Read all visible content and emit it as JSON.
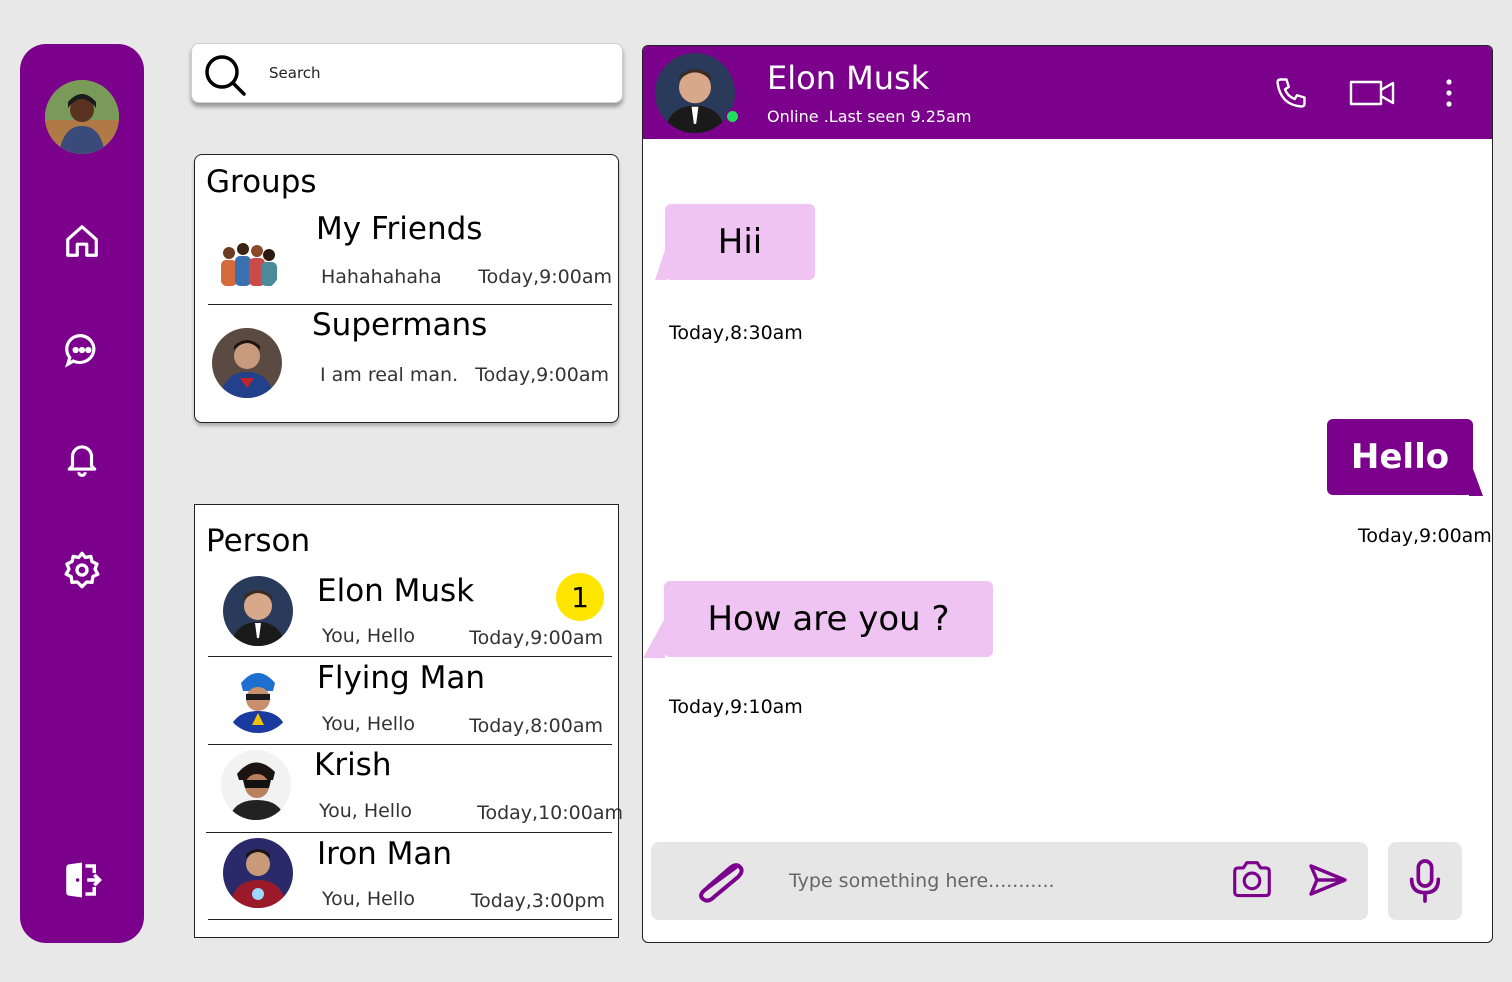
{
  "search": {
    "placeholder": "Search"
  },
  "groups": {
    "title": "Groups",
    "items": [
      {
        "name": "My Friends",
        "message": "Hahahahaha",
        "time": "Today,9:00am"
      },
      {
        "name": "Supermans",
        "message": "I am real man.",
        "time": "Today,9:00am"
      }
    ]
  },
  "persons": {
    "title": "Person",
    "items": [
      {
        "name": "Elon Musk",
        "message": "You, Hello",
        "time": "Today,9:00am",
        "badge": "1"
      },
      {
        "name": "Flying Man",
        "message": "You, Hello",
        "time": "Today,8:00am"
      },
      {
        "name": "Krish",
        "message": "You, Hello",
        "time": "Today,10:00am"
      },
      {
        "name": "Iron Man",
        "message": "You, Hello",
        "time": "Today,3:00pm"
      }
    ]
  },
  "chat": {
    "name": "Elon Musk",
    "status": "Online .Last seen 9.25am",
    "messages": [
      {
        "text": "Hii",
        "time": "Today,8:30am",
        "direction": "in"
      },
      {
        "text": "Hello",
        "time": "Today,9:00am",
        "direction": "out"
      },
      {
        "text": "How are you ?",
        "time": "Today,9:10am",
        "direction": "in"
      }
    ],
    "composer_placeholder": "Type something here..........."
  },
  "colors": {
    "accent": "#7b008c",
    "bubble_in": "#f0c4f2",
    "badge": "#ffe500",
    "online": "#1fe05a"
  },
  "icons": {
    "sidebar": [
      "home-icon",
      "chat-icon",
      "bell-icon",
      "settings-icon",
      "logout-icon"
    ],
    "header": [
      "phone-icon",
      "video-icon",
      "more-vertical-icon"
    ],
    "composer": [
      "paperclip-icon",
      "camera-icon",
      "send-icon",
      "mic-icon"
    ]
  }
}
